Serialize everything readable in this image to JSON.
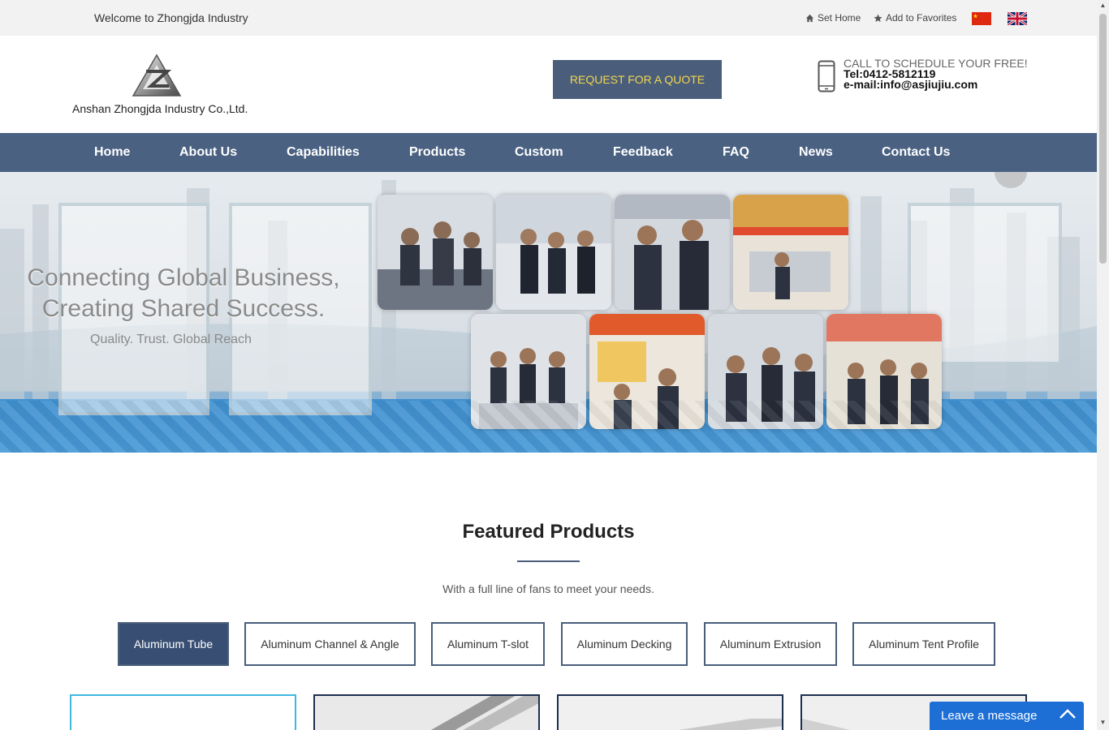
{
  "topbar": {
    "welcome": "Welcome to Zhongjda Industry",
    "set_home": "Set Home",
    "add_favorites": "Add to Favorites"
  },
  "header": {
    "company": "Anshan Zhongjda Industry Co.,Ltd.",
    "quote_button": "REQUEST FOR A QUOTE",
    "call_line": "CALL TO SCHEDULE YOUR FREE!",
    "tel": "Tel:0412-5812119",
    "email": "e-mail:info@asjiujiu.com"
  },
  "nav": {
    "items": [
      "Home",
      "About Us",
      "Capabilities",
      "Products",
      "Custom",
      "Feedback",
      "FAQ",
      "News",
      "Contact Us"
    ]
  },
  "banner": {
    "headline_1": "Connecting Global Business,",
    "headline_2": "Creating Shared Success.",
    "tagline": "Quality. Trust. Global Reach"
  },
  "featured": {
    "title": "Featured Products",
    "subtitle": "With a full line of fans to meet your needs.",
    "tabs": [
      "Aluminum Tube",
      "Aluminum Channel & Angle",
      "Aluminum T-slot",
      "Aluminum Decking",
      "Aluminum Extrusion",
      "Aluminum Tent Profile"
    ],
    "active_tab": "Aluminum Tube"
  },
  "chat": {
    "leave_message": "Leave a message"
  },
  "colors": {
    "nav_bg": "#4a6182",
    "button_bg": "#4a5e7c",
    "button_text": "#f3d64b",
    "active_tab": "#384f73",
    "chat_bg": "#1d6fd6"
  }
}
